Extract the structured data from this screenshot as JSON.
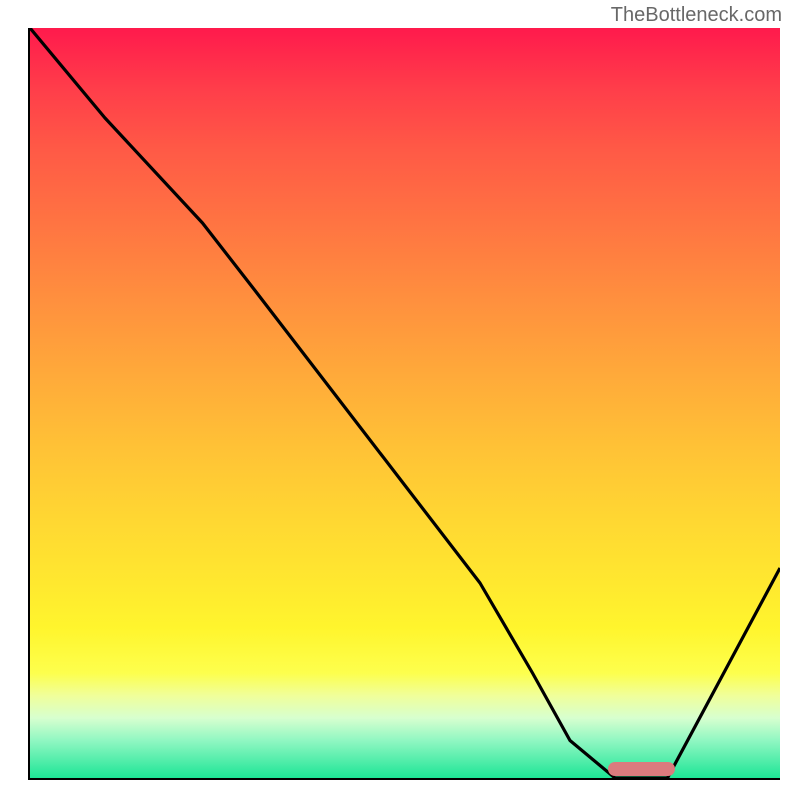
{
  "watermark": "TheBottleneck.com",
  "chart_data": {
    "type": "line",
    "title": "",
    "xlabel": "",
    "ylabel": "",
    "xlim": [
      0,
      100
    ],
    "ylim": [
      0,
      100
    ],
    "x": [
      0,
      10,
      23,
      30,
      40,
      50,
      60,
      67,
      72,
      78,
      85,
      100
    ],
    "values": [
      100,
      88,
      74,
      65,
      52,
      39,
      26,
      14,
      5,
      0,
      0,
      28
    ],
    "background_gradient": {
      "stops": [
        {
          "pct": 0,
          "color": "#ff1a4c"
        },
        {
          "pct": 50,
          "color": "#ffb638"
        },
        {
          "pct": 85,
          "color": "#fff52d"
        },
        {
          "pct": 100,
          "color": "#1de596"
        }
      ]
    },
    "optimal_marker": {
      "x_start": 77,
      "x_end": 86,
      "color": "#db7b7e"
    }
  }
}
